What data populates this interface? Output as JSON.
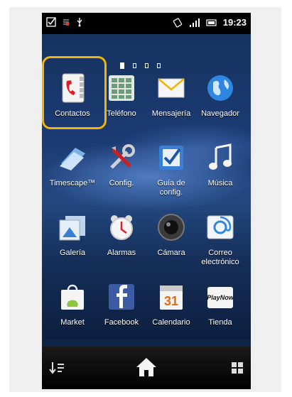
{
  "status_bar": {
    "time": "19:23",
    "left_icons": [
      "checkbox-icon",
      "sync-icon",
      "usb-icon"
    ],
    "right_icons": [
      "vibrate-icon",
      "signal-icon",
      "battery-icon"
    ]
  },
  "pager": {
    "pages": 4,
    "current": 1
  },
  "apps": [
    {
      "id": "contactos",
      "label": "Contactos",
      "icon": "contacts-icon",
      "highlighted": true
    },
    {
      "id": "telefono",
      "label": "Teléfono",
      "icon": "phone-keypad-icon"
    },
    {
      "id": "mensajeria",
      "label": "Mensajería",
      "icon": "envelope-icon"
    },
    {
      "id": "navegador",
      "label": "Navegador",
      "icon": "globe-icon"
    },
    {
      "id": "timescape",
      "label": "Timescape™",
      "icon": "timescape-icon"
    },
    {
      "id": "config",
      "label": "Config.",
      "icon": "tools-icon"
    },
    {
      "id": "guia",
      "label_line1": "Guía de",
      "label_line2": "config.",
      "icon": "checkbox-app-icon"
    },
    {
      "id": "musica",
      "label": "Música",
      "icon": "music-note-icon"
    },
    {
      "id": "galeria",
      "label": "Galería",
      "icon": "gallery-icon"
    },
    {
      "id": "alarmas",
      "label": "Alarmas",
      "icon": "alarm-clock-icon"
    },
    {
      "id": "camara",
      "label": "Cámara",
      "icon": "camera-lens-icon"
    },
    {
      "id": "correo",
      "label_line1": "Correo",
      "label_line2": "electrónico",
      "icon": "email-at-icon"
    },
    {
      "id": "market",
      "label": "Market",
      "icon": "market-bag-icon"
    },
    {
      "id": "facebook",
      "label": "Facebook",
      "icon": "facebook-icon"
    },
    {
      "id": "calendario",
      "label": "Calendario",
      "icon": "calendar-icon",
      "calendar_day": "31"
    },
    {
      "id": "tienda",
      "label": "Tienda",
      "icon": "playnow-icon",
      "badge_text": "PlayNow"
    }
  ],
  "dock": {
    "left_icon": "sort-icon",
    "center_icon": "home-icon",
    "right_icon": "app-grid-icon"
  },
  "colors": {
    "highlight": "#f2b40c",
    "wallpaper_top": "#16325f",
    "wallpaper_bottom": "#0c1f3f"
  }
}
